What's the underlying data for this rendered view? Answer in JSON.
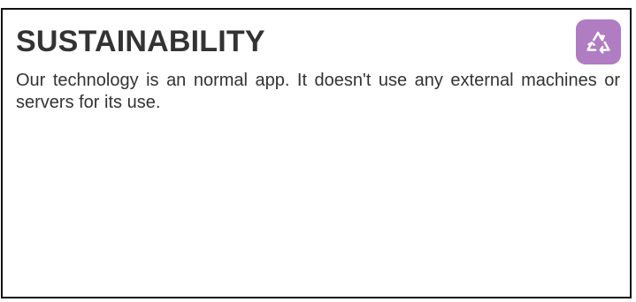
{
  "card": {
    "title": "SUSTAINABILITY",
    "description": "Our technology is an normal app. It doesn't use any external machines or servers for its use.",
    "icon": "recycle-icon",
    "accent_color": "#b07cc2"
  }
}
